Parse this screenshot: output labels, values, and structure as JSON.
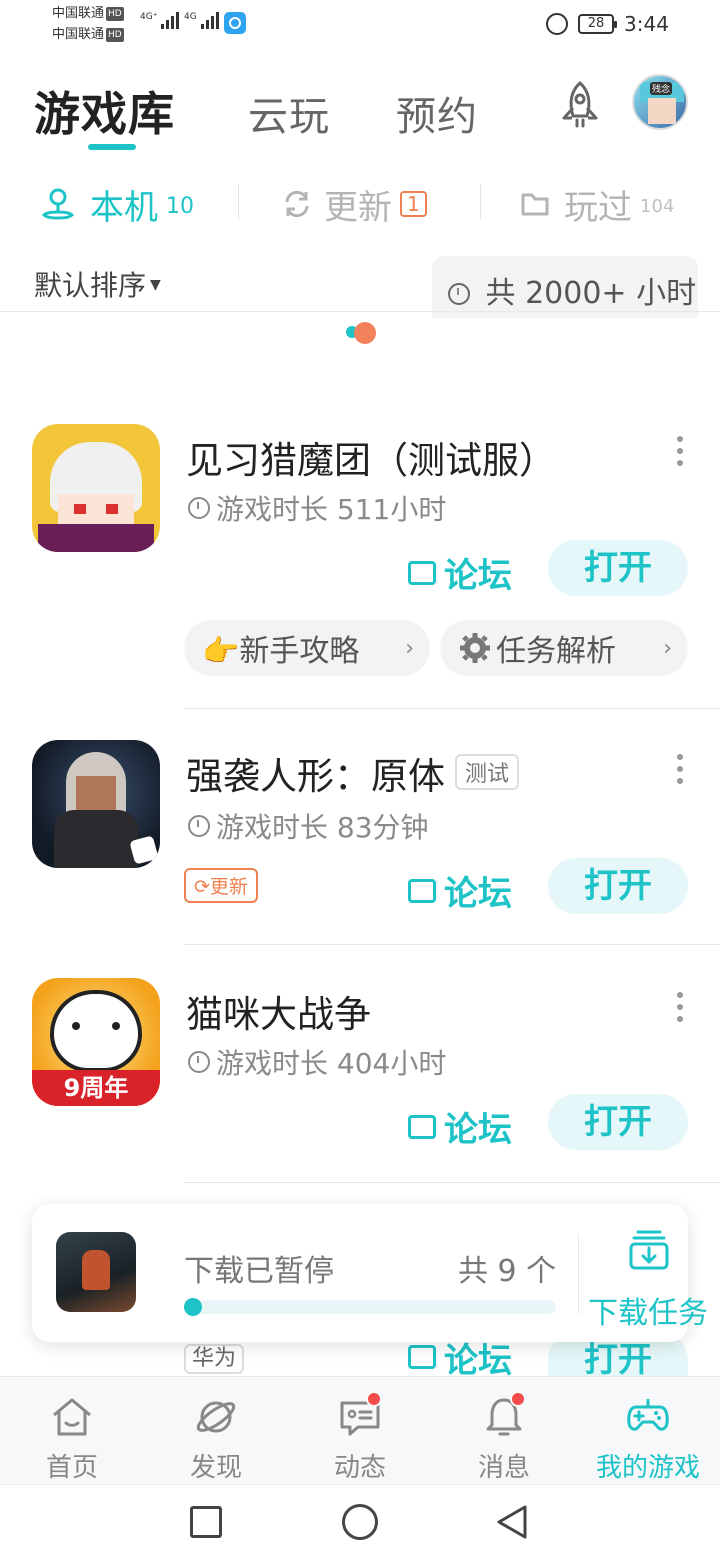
{
  "status_bar": {
    "carrier_1": "中国联通",
    "carrier_2": "中国联通",
    "hd": "HD",
    "network_1": "4G⁺",
    "network_2": "4G",
    "battery": "28",
    "time": "3:44"
  },
  "header": {
    "tabs": [
      {
        "label": "游戏库",
        "active": true
      },
      {
        "label": "云玩",
        "active": false
      },
      {
        "label": "预约",
        "active": false
      }
    ],
    "avatar_text": "残念"
  },
  "subtabs": [
    {
      "label": "本机",
      "count": "10"
    },
    {
      "label": "更新",
      "count": "1"
    },
    {
      "label": "玩过",
      "count": "104"
    }
  ],
  "sort": {
    "label": "默认排序"
  },
  "total_playtime": "共 2000+ 小时",
  "games": [
    {
      "name": "见习猎魔团（测试服）",
      "playtime": "游戏时长 511小时",
      "forum": "论坛",
      "open": "打开",
      "chips": [
        "👉新手攻略",
        "任务解析"
      ]
    },
    {
      "name": "强袭人形：原体",
      "tag": "测试",
      "playtime": "游戏时长 83分钟",
      "update_tag": "更新",
      "forum": "论坛",
      "open": "打开"
    },
    {
      "name": "猫咪大战争",
      "icon_text": "9周年",
      "playtime": "游戏时长 404小时",
      "forum": "论坛",
      "open": "打开"
    },
    {
      "tag": "华为",
      "forum": "论坛",
      "open": "打开"
    }
  ],
  "download": {
    "status": "下载已暂停",
    "count": "共 9 个",
    "action": "下载任务",
    "progress": 0.02
  },
  "bottom_nav": [
    {
      "label": "首页",
      "icon": "home-icon"
    },
    {
      "label": "发现",
      "icon": "planet-icon"
    },
    {
      "label": "动态",
      "icon": "chat-icon",
      "dot": true
    },
    {
      "label": "消息",
      "icon": "bell-icon",
      "dot": true
    },
    {
      "label": "我的游戏",
      "icon": "gamepad-icon",
      "active": true
    }
  ],
  "colors": {
    "accent": "#1ec3c8",
    "update": "#f08150",
    "dot": "#f44b4b"
  }
}
